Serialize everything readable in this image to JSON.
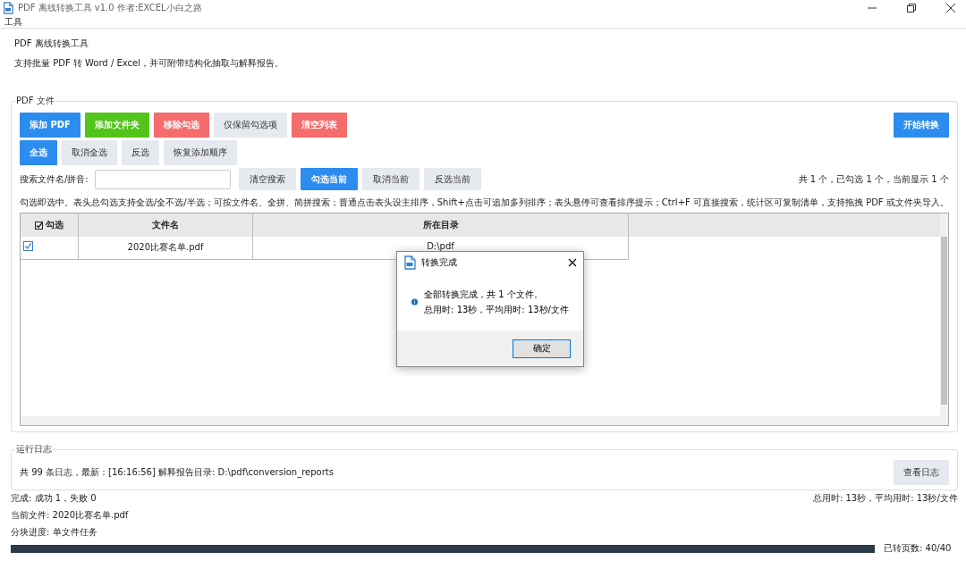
{
  "window": {
    "title": "PDF 离线转换工具 v1.0 作者:EXCEL小白之路"
  },
  "menu": [
    "工具"
  ],
  "header": {
    "title": "PDF 离线转换工具",
    "description": "支持批量 PDF 转 Word / Excel，并可附带结构化抽取与解释报告。"
  },
  "files_group": {
    "label": "PDF 文件",
    "buttons_row1": [
      {
        "label": "添加 PDF",
        "kind": "primary"
      },
      {
        "label": "添加文件夹",
        "kind": "success"
      },
      {
        "label": "移除勾选",
        "kind": "danger"
      },
      {
        "label": "仅保留勾选项",
        "kind": "plain"
      },
      {
        "label": "清空列表",
        "kind": "danger"
      }
    ],
    "start_button": {
      "label": "开始转换",
      "kind": "primary"
    },
    "buttons_row2": [
      {
        "label": "全选",
        "kind": "primary"
      },
      {
        "label": "取消全选",
        "kind": "plain"
      },
      {
        "label": "反选",
        "kind": "plain"
      },
      {
        "label": "恢复添加顺序",
        "kind": "plain"
      }
    ],
    "search": {
      "label": "搜索文件名/拼音:"
    },
    "search_buttons": [
      {
        "label": "清空搜索",
        "kind": "plain"
      },
      {
        "label": "勾选当前",
        "kind": "primary"
      },
      {
        "label": "取消当前",
        "kind": "plain"
      },
      {
        "label": "反选当前",
        "kind": "plain"
      }
    ],
    "stats": "共 1 个，已勾选 1 个，当前显示 1 个",
    "hint": "勾选即选中。表头总勾选支持全选/全不选/半选；可按文件名、全拼、简拼搜索；普通点击表头设主排序，Shift+点击可追加多列排序；表头悬停可查看排序提示；Ctrl+F 可直接搜索，统计区可复制清单，支持拖拽 PDF 或文件夹导入。",
    "table": {
      "all_checked": true,
      "columns": [
        "勾选",
        "文件名",
        "所在目录"
      ],
      "rows": [
        {
          "checked": true,
          "name": "2020比赛名单.pdf",
          "folder": "D:\\pdf"
        }
      ]
    }
  },
  "dialog": {
    "title": "转换完成",
    "lines": [
      "全部转换完成，共 1 个文件。",
      "总用时: 13秒，平均用时: 13秒/文件"
    ],
    "button": "确定"
  },
  "log_group": {
    "label": "运行日志",
    "summary": "共 99 条日志，最新：[16:16:56] 解释报告目录: D:\\pdf\\conversion_reports",
    "button": "查看日志"
  },
  "status": {
    "result": "完成: 成功 1，失败 0",
    "timing": "总用时: 13秒，平均用时: 13秒/文件",
    "current_file": "当前文件: 2020比赛名单.pdf",
    "chunk": "分块进度: 单文件任务",
    "progress": {
      "level": 1,
      "reading": "已转页数: 40/40"
    }
  }
}
